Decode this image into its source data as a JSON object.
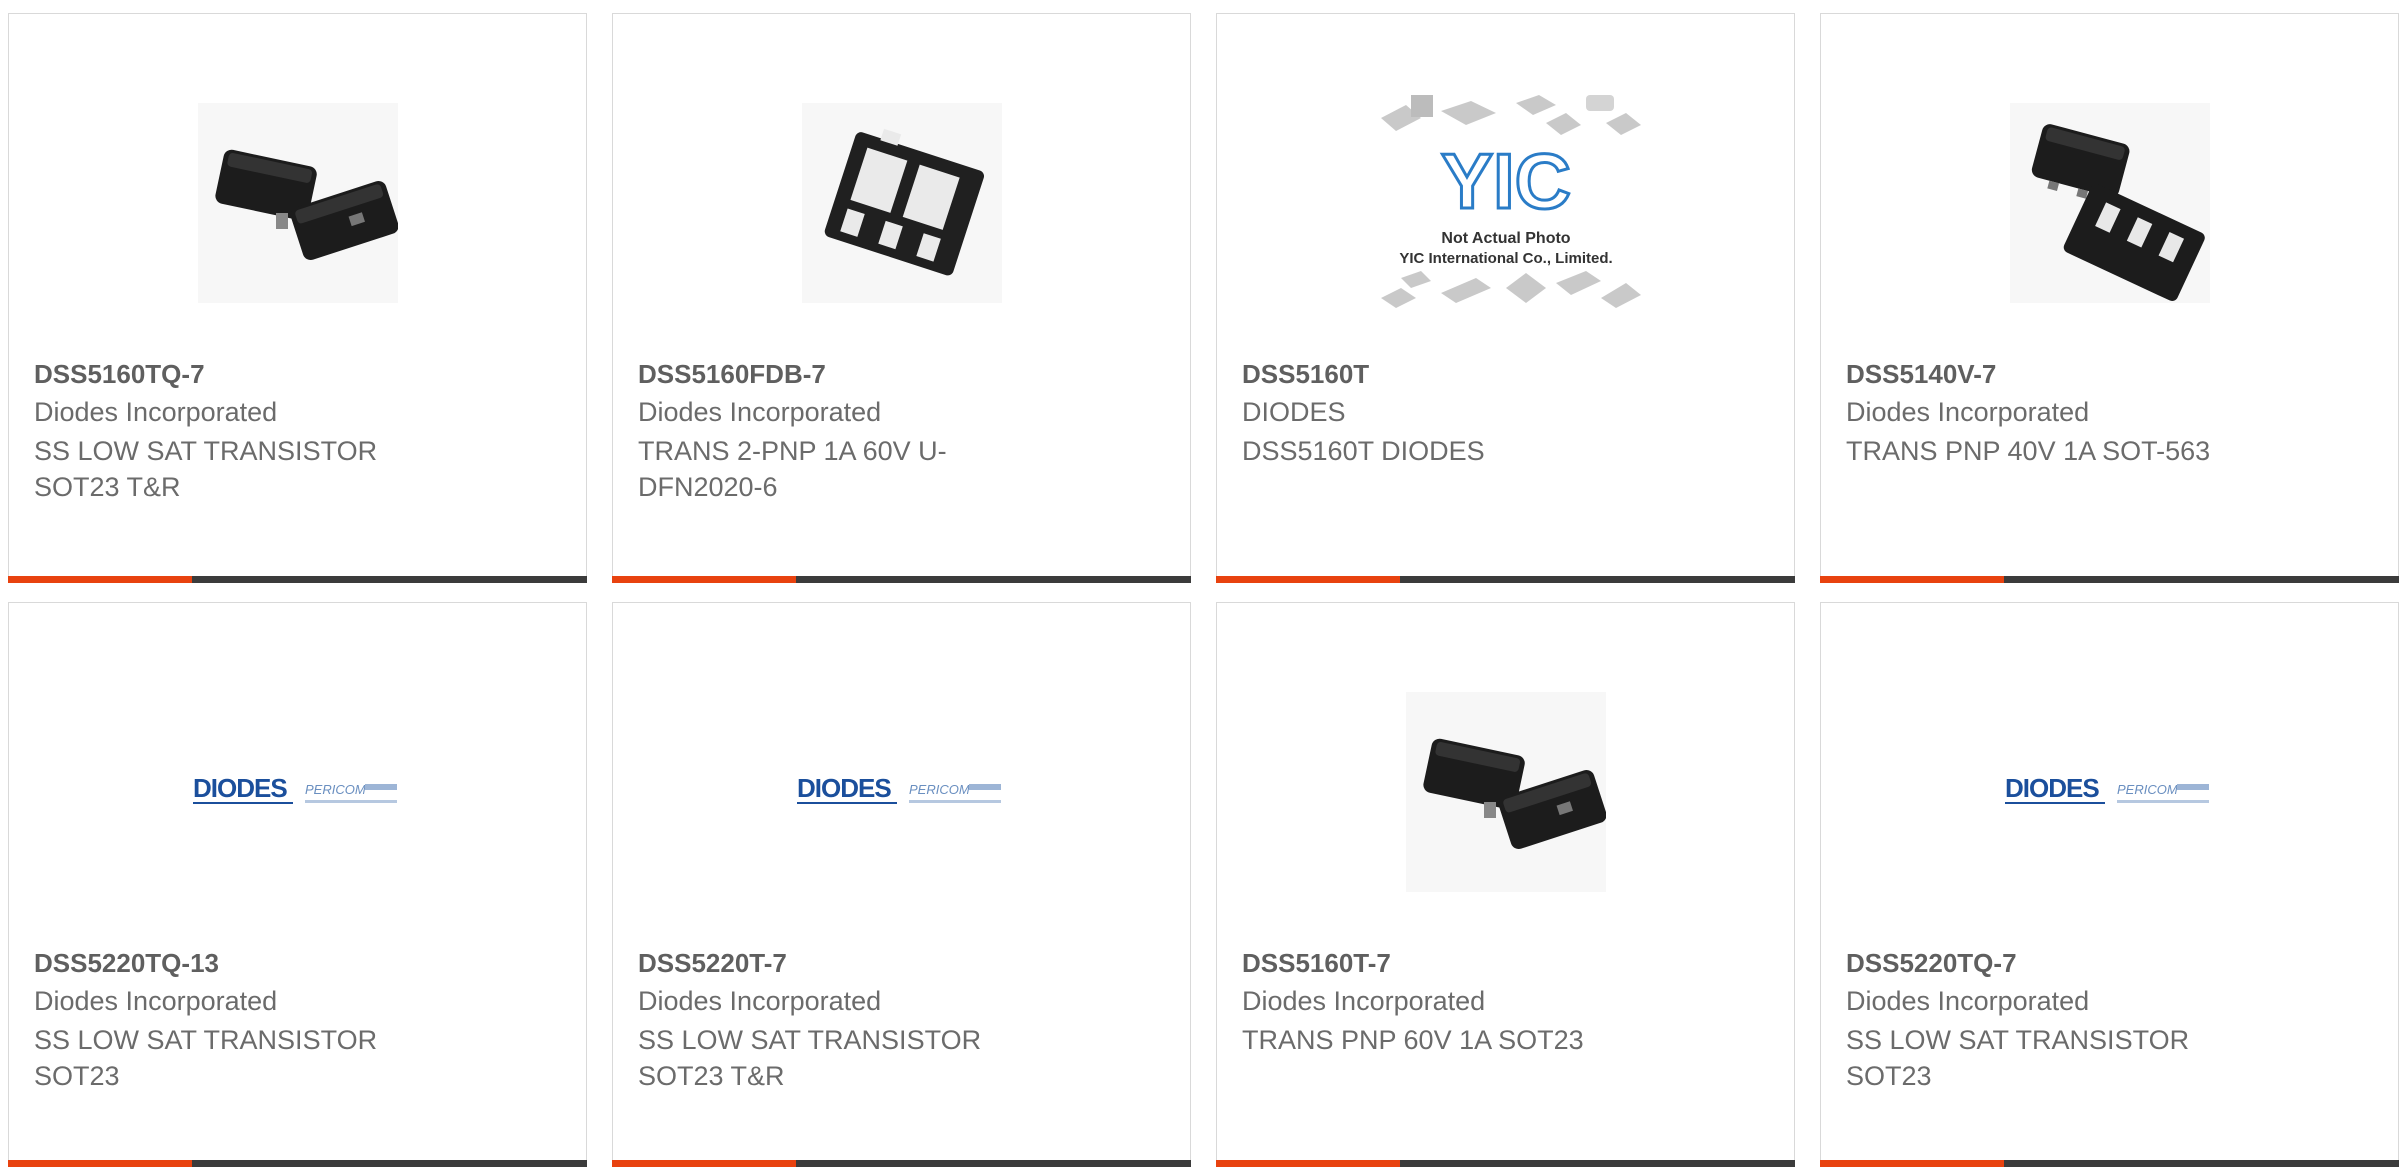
{
  "products": [
    {
      "part": "DSS5160TQ-7",
      "maker": "Diodes Incorporated",
      "desc": "SS LOW SAT TRANSISTOR SOT23 T&R",
      "image": "sot23-package-icon"
    },
    {
      "part": "DSS5160FDB-7",
      "maker": "Diodes Incorporated",
      "desc": "TRANS 2-PNP 1A 60V U-DFN2020-6",
      "image": "udfn-package-icon"
    },
    {
      "part": "DSS5160T",
      "maker": "DIODES",
      "desc": "DSS5160T DIODES",
      "image": "not-actual-photo-placeholder",
      "placeholder_lines": [
        "Not Actual Photo",
        "YIC International Co., Limited."
      ],
      "placeholder_logo": "YIC"
    },
    {
      "part": "DSS5140V-7",
      "maker": "Diodes Incorporated",
      "desc": "TRANS PNP 40V 1A SOT-563",
      "image": "sot563-package-icon"
    },
    {
      "part": "DSS5220TQ-13",
      "maker": "Diodes Incorporated",
      "desc": "SS LOW SAT TRANSISTOR SOT23",
      "image": "diodes-pericom-logo",
      "logo_text": "DIODES",
      "logo_text2": "PERICOM"
    },
    {
      "part": "DSS5220T-7",
      "maker": "Diodes Incorporated",
      "desc": "SS LOW SAT TRANSISTOR SOT23 T&R",
      "image": "diodes-pericom-logo",
      "logo_text": "DIODES",
      "logo_text2": "PERICOM"
    },
    {
      "part": "DSS5160T-7",
      "maker": "Diodes Incorporated",
      "desc": "TRANS PNP 60V 1A SOT23",
      "image": "sot23-package-icon"
    },
    {
      "part": "DSS5220TQ-7",
      "maker": "Diodes Incorporated",
      "desc": "SS LOW SAT TRANSISTOR SOT23",
      "image": "diodes-pericom-logo",
      "logo_text": "DIODES",
      "logo_text2": "PERICOM"
    }
  ],
  "colors": {
    "accent": "#e8420f",
    "bar": "#3b3b3b",
    "border": "#d9d9d9",
    "logo_blue": "#1b4f9c"
  }
}
